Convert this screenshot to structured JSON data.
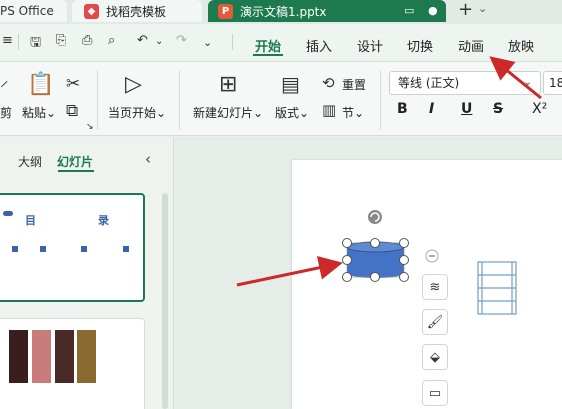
{
  "tabs": {
    "wps": "PS Office",
    "templates": "找稻壳模板",
    "document": "演示文稿1.pptx",
    "doc_icon": "P",
    "add": "+",
    "add_chevron": "⌄"
  },
  "ribbon_tabs": [
    "开始",
    "插入",
    "设计",
    "切换",
    "动画",
    "放映"
  ],
  "ribbon": {
    "cut_label": "剪切",
    "cut_partial": "剪",
    "paste_label": "粘贴",
    "play_from_current": "当页开始",
    "new_slide": "新建幻灯片",
    "layout": "版式",
    "reset": "重置",
    "section": "节",
    "font_name": "等线 (正文)",
    "font_size": "18",
    "bold": "B",
    "italic": "I",
    "underline": "U",
    "strike": "S",
    "superscript": "X²"
  },
  "panel": {
    "outline_tab": "大纲",
    "slides_tab": "幻灯片",
    "thumb1_text_a": "目",
    "thumb1_text_b": "录"
  },
  "icons": {
    "save": "save-icon",
    "undo": "undo-icon",
    "redo": "redo-icon",
    "print": "print-icon",
    "play": "play-icon"
  },
  "colors": {
    "accent": "#1d7a4f",
    "shape": "#4472c4",
    "arrow": "#cc2a2a"
  }
}
